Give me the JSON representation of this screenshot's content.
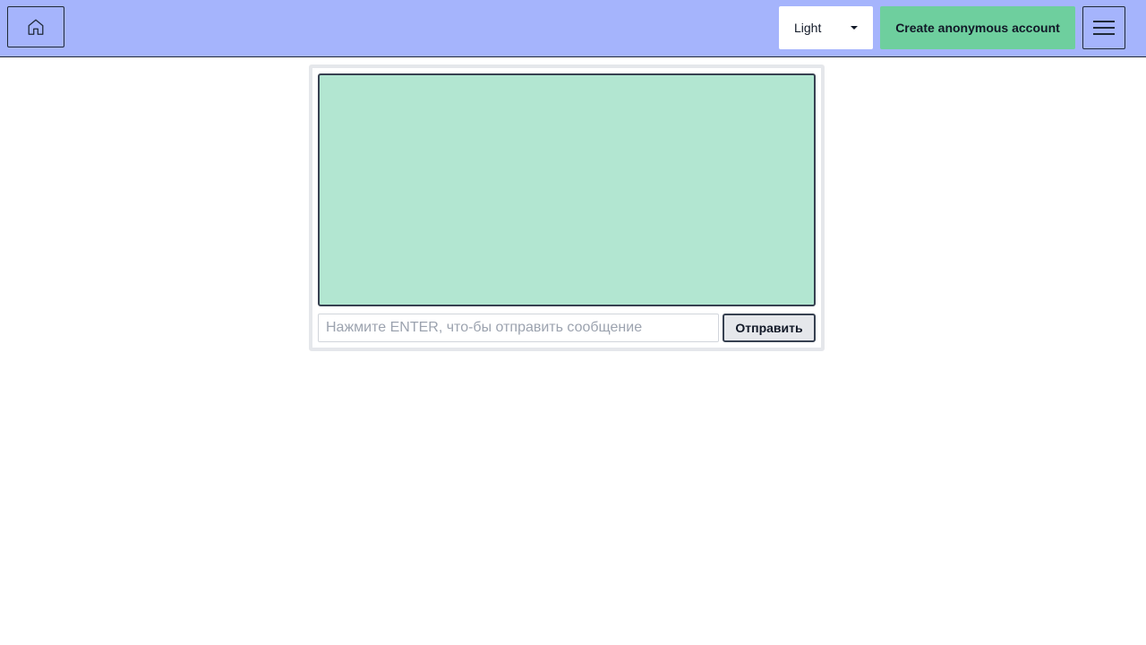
{
  "header": {
    "home_icon": "home-icon",
    "theme_select": {
      "selected": "Light",
      "icon": "caret-down-icon"
    },
    "create_account_label": "Create anonymous account",
    "menu_icon": "hamburger-menu-icon"
  },
  "chat": {
    "input": {
      "value": "",
      "placeholder": "Нажмите ENTER, что-бы отправить сообщение"
    },
    "send_label": "Отправить"
  },
  "colors": {
    "header_bg": "#a5b4fc",
    "create_button_bg": "#6ecf9e",
    "messages_bg": "#b2e6d1"
  }
}
